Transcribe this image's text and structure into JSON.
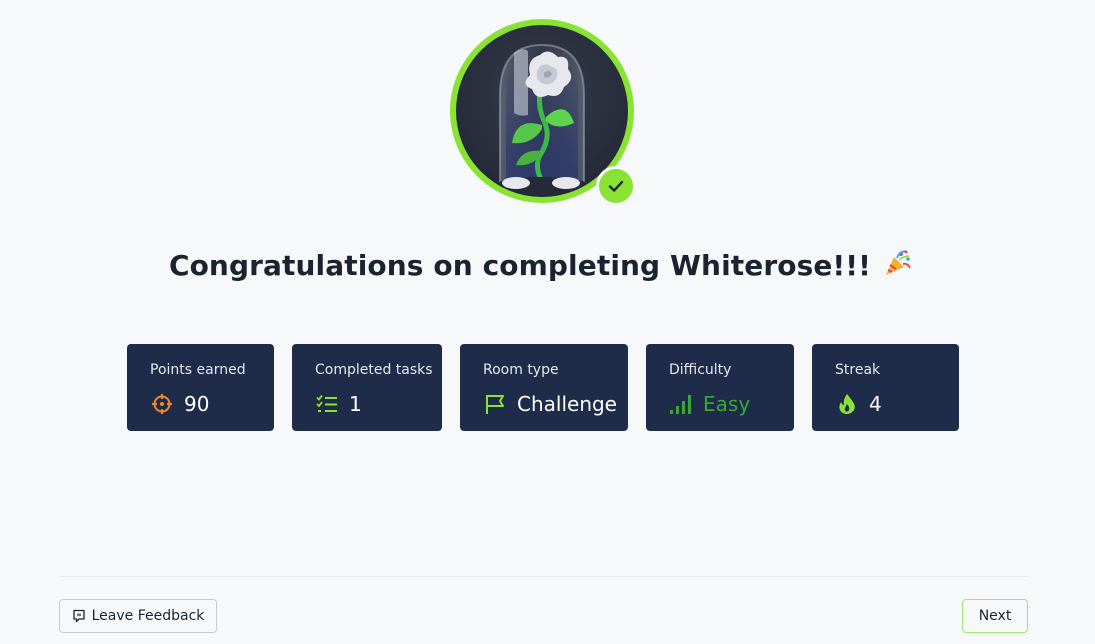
{
  "room": {
    "badge_icon": "white-rose-in-glass-dome-icon",
    "completed_icon": "check-icon",
    "title": "Congratulations on completing Whiterose!!!",
    "title_emoji_icon": "party-popper-icon"
  },
  "stats": [
    {
      "label": "Points earned",
      "value": "90",
      "icon": "crosshair-icon",
      "icon_color": "#f08a24"
    },
    {
      "label": "Completed tasks",
      "value": "1",
      "icon": "checklist-icon",
      "icon_color": "#8ae234"
    },
    {
      "label": "Room type",
      "value": "Challenge",
      "icon": "flag-icon",
      "icon_color": "#8ae234"
    },
    {
      "label": "Difficulty",
      "value": "Easy",
      "icon": "signal-bars-icon",
      "icon_color": "#3aa636"
    },
    {
      "label": "Streak",
      "value": "4",
      "icon": "flame-icon",
      "icon_color": "#8ae234"
    }
  ],
  "footer": {
    "feedback_label": "Leave Feedback",
    "feedback_icon": "message-icon",
    "next_label": "Next"
  },
  "colors": {
    "accent": "#8ae234",
    "card_background": "#1f2c49",
    "page_background": "#f7f8fa",
    "difficulty_easy": "#3aa636",
    "points_icon": "#f08a24"
  }
}
